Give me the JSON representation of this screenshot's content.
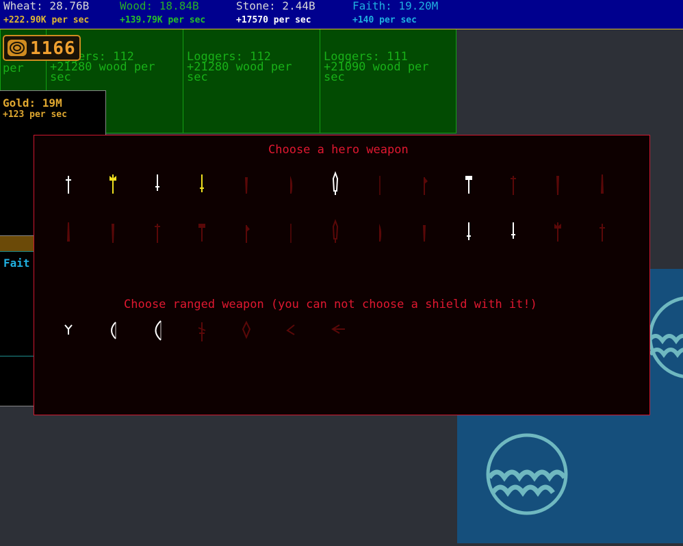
{
  "resources": [
    {
      "name": "Wheat: 28.76B",
      "rate": "+222.90K per sec",
      "color": "#d8d8d8",
      "rate_color": "#e0b830"
    },
    {
      "name": "Wood: 18.84B",
      "rate": "+139.79K per sec",
      "color": "#28b028",
      "rate_color": "#28c028"
    },
    {
      "name": "Stone: 2.44B",
      "rate": "+17570 per sec",
      "color": "#d8d8d8",
      "rate_color": "#ffffff"
    },
    {
      "name": "Faith: 19.20M",
      "rate": "+140 per sec",
      "color": "#20b0e0",
      "rate_color": "#20b0e0"
    }
  ],
  "badge": {
    "value": "1166",
    "icon": "coin-stack-icon"
  },
  "buildings": [
    {
      "label": "per",
      "rate": "",
      "extra": ""
    },
    {
      "label": "Loggers: 112",
      "rate": "+21280 wood per",
      "extra": "sec"
    },
    {
      "label": "Loggers: 112",
      "rate": "+21280 wood per",
      "extra": "sec"
    },
    {
      "label": "Loggers: 111",
      "rate": "+21090 wood per",
      "extra": "sec"
    }
  ],
  "gold": {
    "name": "Gold: 19M",
    "rate": "+123 per sec"
  },
  "faith_panel": {
    "name": "Fait"
  },
  "modal": {
    "title": "Choose a hero weapon",
    "ranged_title": "Choose ranged weapon (you can not choose a shield with it!)",
    "melee_row1": [
      {
        "icon": "short-sword-icon",
        "state": "available"
      },
      {
        "icon": "golden-axe-icon",
        "state": "selected"
      },
      {
        "icon": "dagger-icon",
        "state": "available"
      },
      {
        "icon": "golden-dagger-icon",
        "state": "selected"
      },
      {
        "icon": "locked-sword-icon",
        "state": "locked"
      },
      {
        "icon": "locked-scimitar-icon",
        "state": "locked"
      },
      {
        "icon": "longsword-icon",
        "state": "available"
      },
      {
        "icon": "locked-rapier-icon",
        "state": "locked"
      },
      {
        "icon": "locked-axe-icon",
        "state": "locked"
      },
      {
        "icon": "hammer-icon",
        "state": "available"
      },
      {
        "icon": "locked-mace-icon",
        "state": "locked"
      },
      {
        "icon": "locked-club-icon",
        "state": "locked"
      },
      {
        "icon": "locked-greatsword-icon",
        "state": "locked"
      }
    ],
    "melee_row2": [
      {
        "icon": "locked-flail-icon",
        "state": "locked"
      },
      {
        "icon": "locked-trident-icon",
        "state": "locked"
      },
      {
        "icon": "locked-mace2-icon",
        "state": "locked"
      },
      {
        "icon": "locked-morningstar-icon",
        "state": "locked"
      },
      {
        "icon": "locked-staff-icon",
        "state": "locked"
      },
      {
        "icon": "locked-pike-icon",
        "state": "locked"
      },
      {
        "icon": "locked-halberd-icon",
        "state": "locked"
      },
      {
        "icon": "locked-glaive-icon",
        "state": "locked"
      },
      {
        "icon": "locked-scythe-icon",
        "state": "locked"
      },
      {
        "icon": "staff-icon",
        "state": "available"
      },
      {
        "icon": "spear-icon",
        "state": "available"
      },
      {
        "icon": "locked-crook-icon",
        "state": "locked"
      },
      {
        "icon": "locked-lance-icon",
        "state": "locked"
      }
    ],
    "ranged": [
      {
        "icon": "slingshot-icon",
        "state": "available"
      },
      {
        "icon": "short-bow-icon",
        "state": "available"
      },
      {
        "icon": "long-bow-icon",
        "state": "available"
      },
      {
        "icon": "locked-crossbow-icon",
        "state": "locked"
      },
      {
        "icon": "locked-compound-bow-icon",
        "state": "locked"
      },
      {
        "icon": "locked-throwing-knife-icon",
        "state": "locked"
      },
      {
        "icon": "locked-arrow-launcher-icon",
        "state": "locked"
      }
    ]
  },
  "colors": {
    "available": "#ffffff",
    "selected": "#f0e020",
    "locked": "#5a0808"
  }
}
